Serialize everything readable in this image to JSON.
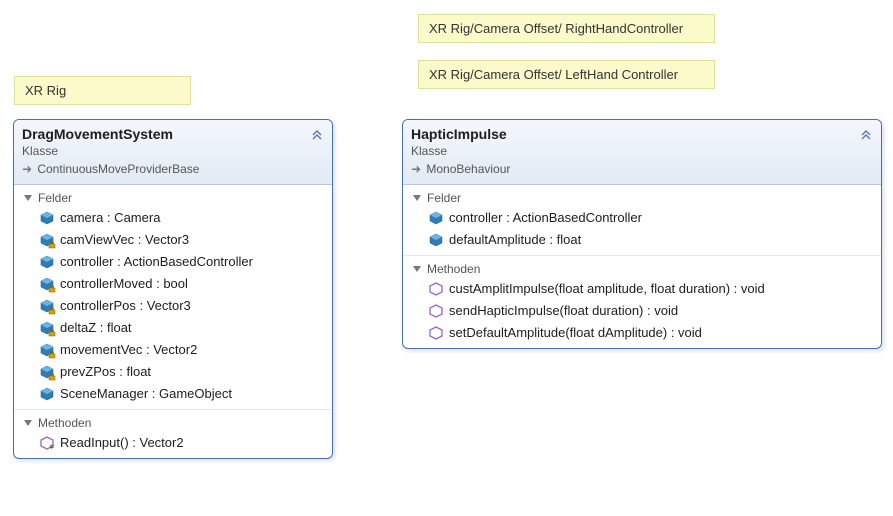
{
  "notes": {
    "n1": "XR Rig",
    "n2": "XR Rig/Camera Offset/ RightHandController",
    "n3": "XR Rig/Camera Offset/ LeftHand Controller"
  },
  "classA": {
    "title": "DragMovementSystem",
    "stereotype": "Klasse",
    "base": "ContinuousMoveProviderBase",
    "section_fields": "Felder",
    "section_methods": "Methoden",
    "fields": [
      {
        "label": "camera : Camera",
        "private": false
      },
      {
        "label": "camViewVec : Vector3",
        "private": true
      },
      {
        "label": "controller : ActionBasedController",
        "private": false
      },
      {
        "label": "controllerMoved : bool",
        "private": true
      },
      {
        "label": "controllerPos : Vector3",
        "private": true
      },
      {
        "label": "deltaZ : float",
        "private": true
      },
      {
        "label": "movementVec : Vector2",
        "private": true
      },
      {
        "label": "prevZPos : float",
        "private": true
      },
      {
        "label": "SceneManager : GameObject",
        "private": false
      }
    ],
    "methods": [
      {
        "label": "ReadInput() : Vector2",
        "override": true
      }
    ]
  },
  "classB": {
    "title": "HapticImpulse",
    "stereotype": "Klasse",
    "base": "MonoBehaviour",
    "section_fields": "Felder",
    "section_methods": "Methoden",
    "fields": [
      {
        "label": "controller : ActionBasedController",
        "private": false
      },
      {
        "label": "defaultAmplitude : float",
        "private": false
      }
    ],
    "methods": [
      {
        "label": "custAmplitImpulse(float amplitude, float duration) : void",
        "override": false
      },
      {
        "label": "sendHapticImpulse(float duration) : void",
        "override": false
      },
      {
        "label": "setDefaultAmplitude(float dAmplitude) : void",
        "override": false
      }
    ]
  }
}
